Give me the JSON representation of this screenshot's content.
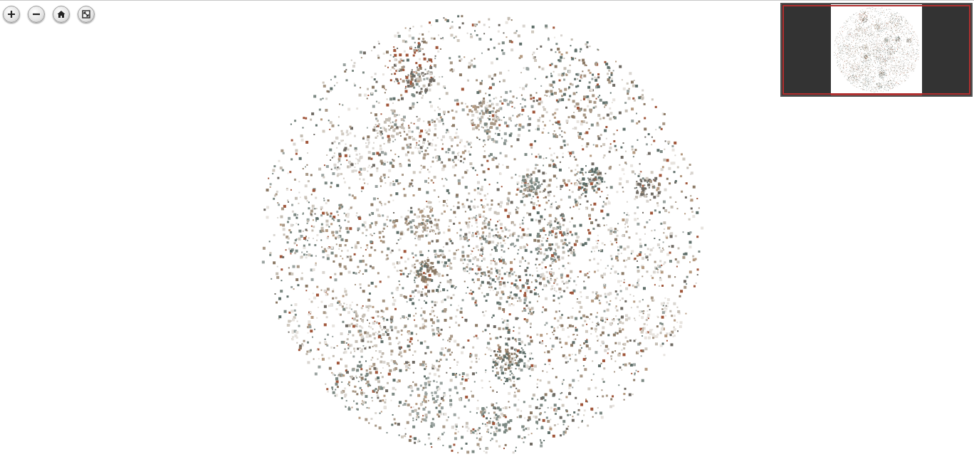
{
  "toolbar": {
    "buttons": [
      {
        "action": "zoom-in",
        "disabled": false
      },
      {
        "action": "zoom-out",
        "disabled": false
      },
      {
        "action": "home",
        "disabled": false
      },
      {
        "action": "full-page",
        "disabled": false
      }
    ]
  },
  "navigator": {
    "shown": true
  }
}
